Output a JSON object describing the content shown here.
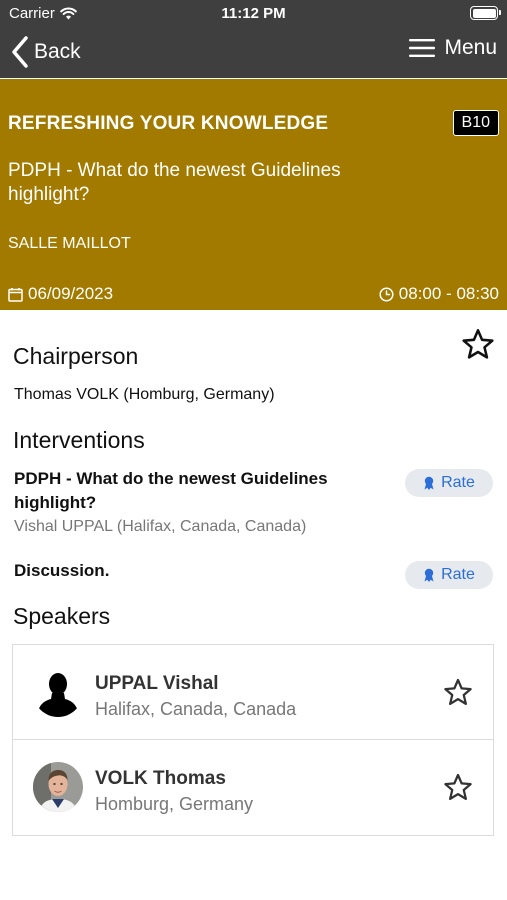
{
  "status_bar": {
    "carrier": "Carrier",
    "time": "11:12 PM",
    "battery_level": 1.0
  },
  "nav": {
    "back_label": "Back",
    "menu_label": "Menu"
  },
  "session": {
    "category": "REFRESHING YOUR KNOWLEDGE",
    "code": "B10",
    "title": "PDPH - What do the newest Guidelines highlight?",
    "room": "SALLE MAILLOT",
    "date": "06/09/2023",
    "time_range": "08:00 - 08:30"
  },
  "chairperson": {
    "heading": "Chairperson",
    "name": "Thomas VOLK (Homburg, Germany)"
  },
  "interventions": {
    "heading": "Interventions",
    "items": [
      {
        "title": "PDPH - What do the newest Guidelines highlight?",
        "speaker": "Vishal UPPAL (Halifax, Canada, Canada)",
        "rate_label": "Rate"
      },
      {
        "title": "Discussion.",
        "speaker": "",
        "rate_label": "Rate"
      }
    ]
  },
  "speakers": {
    "heading": "Speakers",
    "items": [
      {
        "name": "UPPAL Vishal",
        "affiliation": "Halifax, Canada, Canada",
        "avatar": "silhouette-placeholder"
      },
      {
        "name": "VOLK Thomas",
        "affiliation": "Homburg, Germany",
        "avatar": "portrait-photo"
      }
    ]
  },
  "colors": {
    "bar": "#3f3f3f",
    "hero": "#a37a00",
    "link": "#2b6fd6",
    "rate_bg": "#e6e9ee"
  }
}
